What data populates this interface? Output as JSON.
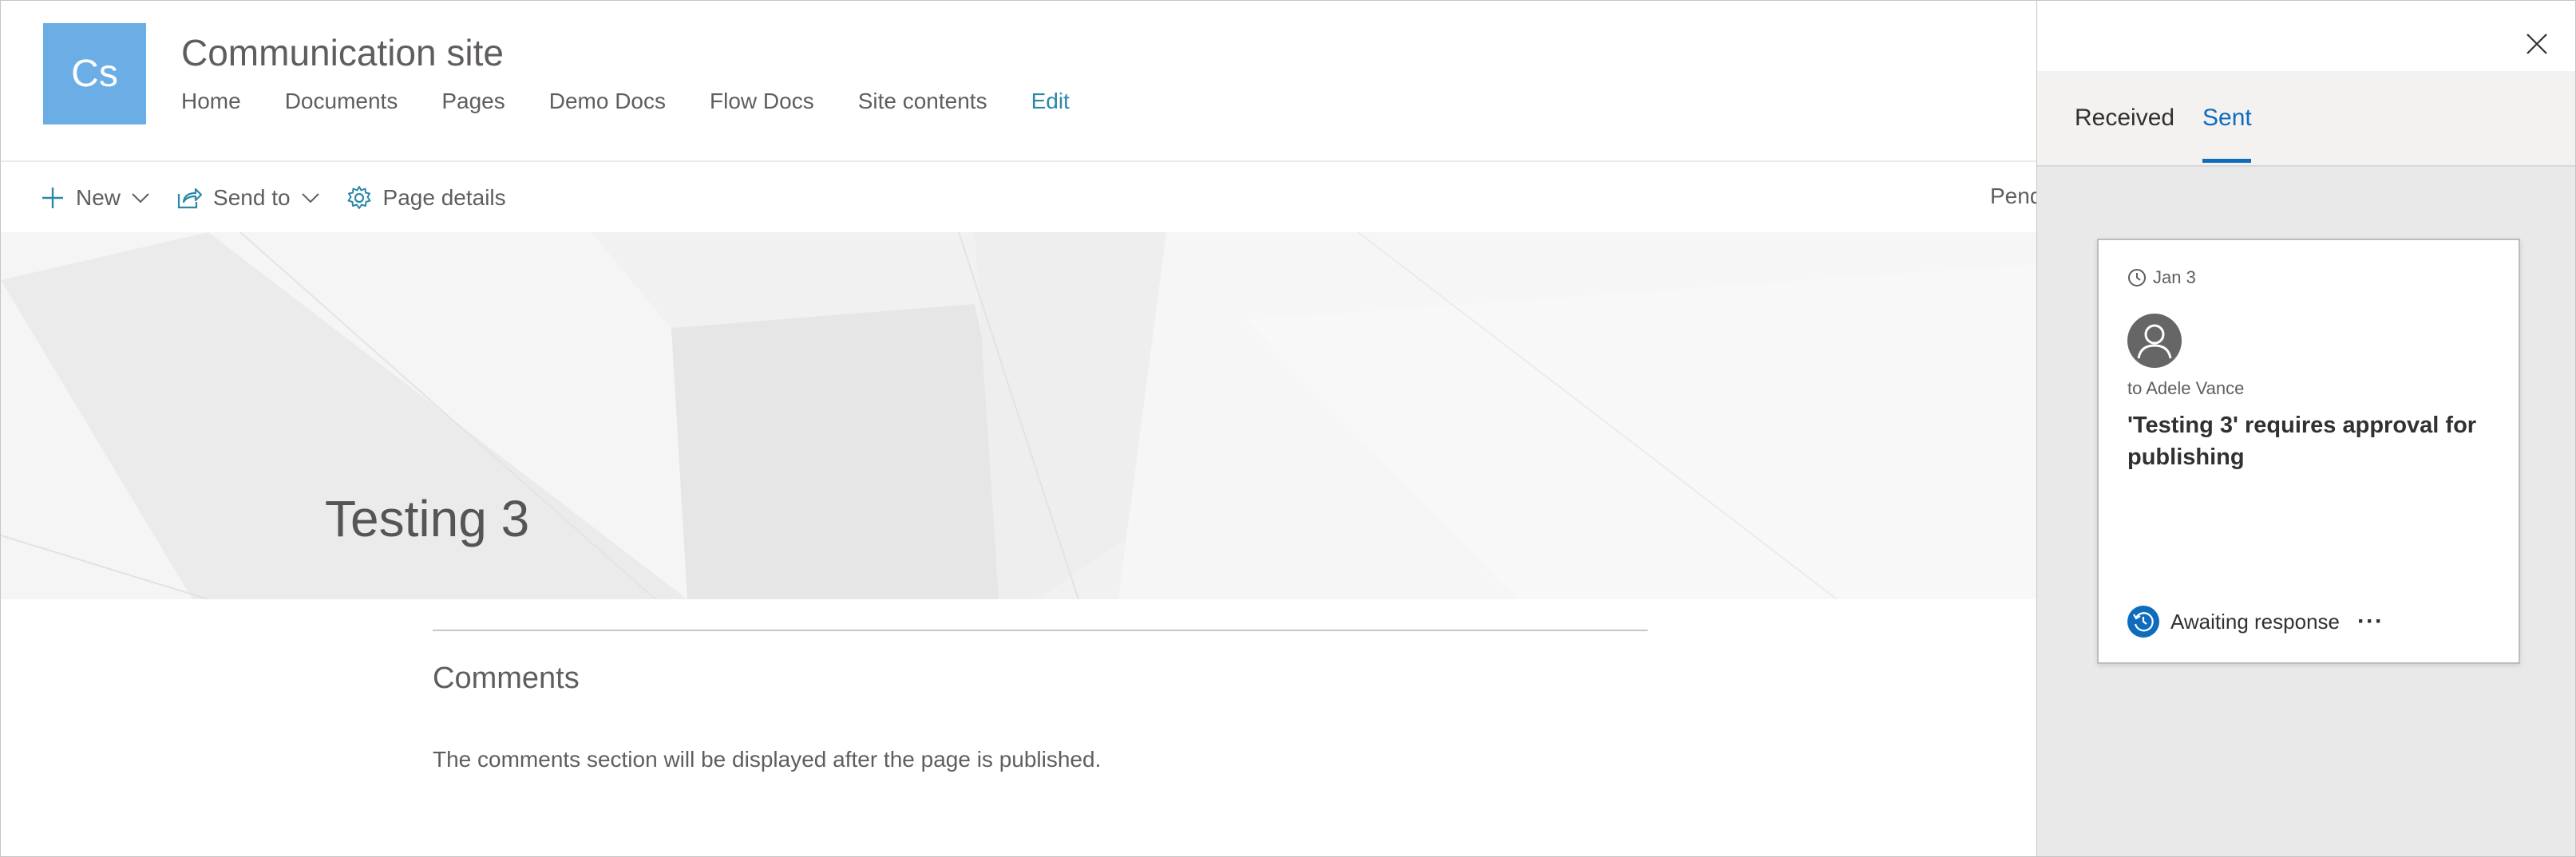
{
  "site": {
    "logo_initials": "Cs",
    "title": "Communication site",
    "nav": [
      "Home",
      "Documents",
      "Pages",
      "Demo Docs",
      "Flow Docs",
      "Site contents",
      "Edit"
    ]
  },
  "commandbar": {
    "new_label": "New",
    "send_to_label": "Send to",
    "page_details_label": "Page details",
    "truncated_status": "Pend"
  },
  "page": {
    "title": "Testing 3",
    "comments_heading": "Comments",
    "comments_note": "The comments section will be displayed after the page is published."
  },
  "panel": {
    "tabs": {
      "received": "Received",
      "sent": "Sent",
      "active": "sent"
    },
    "card": {
      "date": "Jan 3",
      "recipient": "to Adele Vance",
      "title": "'Testing 3' requires approval for publishing",
      "status": "Awaiting response",
      "more": "···"
    }
  },
  "icons": {
    "new": "plus-icon",
    "send_to": "share-icon",
    "page_details": "gear-icon",
    "close": "close-icon",
    "date": "clock-icon",
    "avatar": "person-icon",
    "status": "history-icon"
  },
  "colors": {
    "logo_bg": "#6aaee5",
    "accent": "#0f6cbd",
    "edit_link": "#2b88a8",
    "panel_bg": "#e9e9e9"
  }
}
